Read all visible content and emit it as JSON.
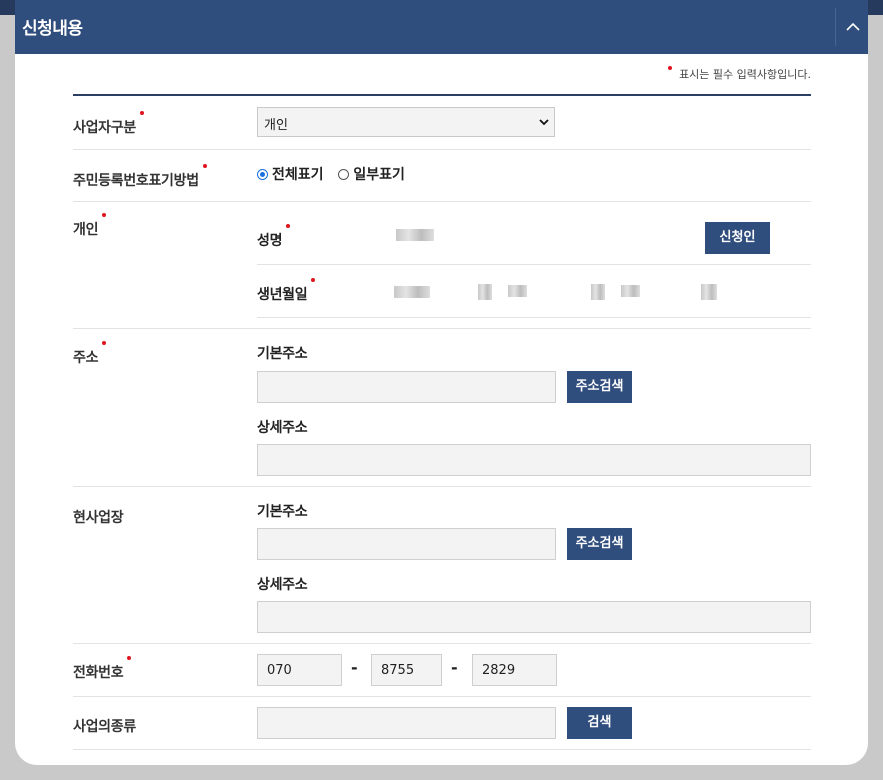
{
  "panel": {
    "title": "신청내용"
  },
  "required_note": "표시는 필수 입력사항입니다.",
  "applicant_type": {
    "label": "사업자구분",
    "value": "개인"
  },
  "id_display": {
    "label": "주민등록번호표기방법",
    "options": [
      {
        "label": "전체표기",
        "checked": true
      },
      {
        "label": "일부표기",
        "checked": false
      }
    ]
  },
  "personal": {
    "label": "개인",
    "name_label": "성명",
    "name_button": "신청인",
    "birth_label": "생년월일"
  },
  "address": {
    "label": "주소",
    "basic_label": "기본주소",
    "search_button": "주소검색",
    "detail_label": "상세주소"
  },
  "worksite": {
    "label": "현사업장",
    "basic_label": "기본주소",
    "search_button": "주소검색",
    "detail_label": "상세주소"
  },
  "phone": {
    "label": "전화번호",
    "parts": [
      "070",
      "8755",
      "2829"
    ],
    "separator": "-"
  },
  "business_type": {
    "label": "사업의종류",
    "search_button": "검색"
  },
  "colors": {
    "header": "#2f4d7d",
    "button": "#2f4d7d",
    "required": "#e0141e"
  }
}
